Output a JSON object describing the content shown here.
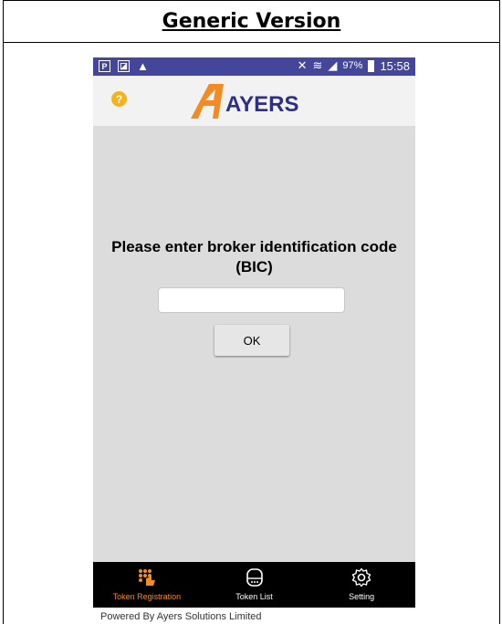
{
  "document": {
    "title": "Generic Version"
  },
  "statusbar": {
    "signal": "97%",
    "time": "15:58"
  },
  "appbar": {
    "help_icon": "?",
    "logo_text": "AYERS"
  },
  "main": {
    "prompt_line1": "Please enter broker identification code",
    "prompt_line2": "(BIC)",
    "bic_value": "",
    "ok_label": "OK"
  },
  "nav": {
    "items": [
      {
        "label": "Token Registration",
        "icon": "token-registration-icon",
        "active": true
      },
      {
        "label": "Token List",
        "icon": "token-list-icon",
        "active": false
      },
      {
        "label": "Setting",
        "icon": "gear-icon",
        "active": false
      }
    ]
  },
  "footer": {
    "powered": "Powered By Ayers Solutions Limited"
  },
  "colors": {
    "statusbar": "#43469b",
    "accent": "#f28c22",
    "logo_blue": "#2d2f86",
    "help": "#f5b21b"
  }
}
